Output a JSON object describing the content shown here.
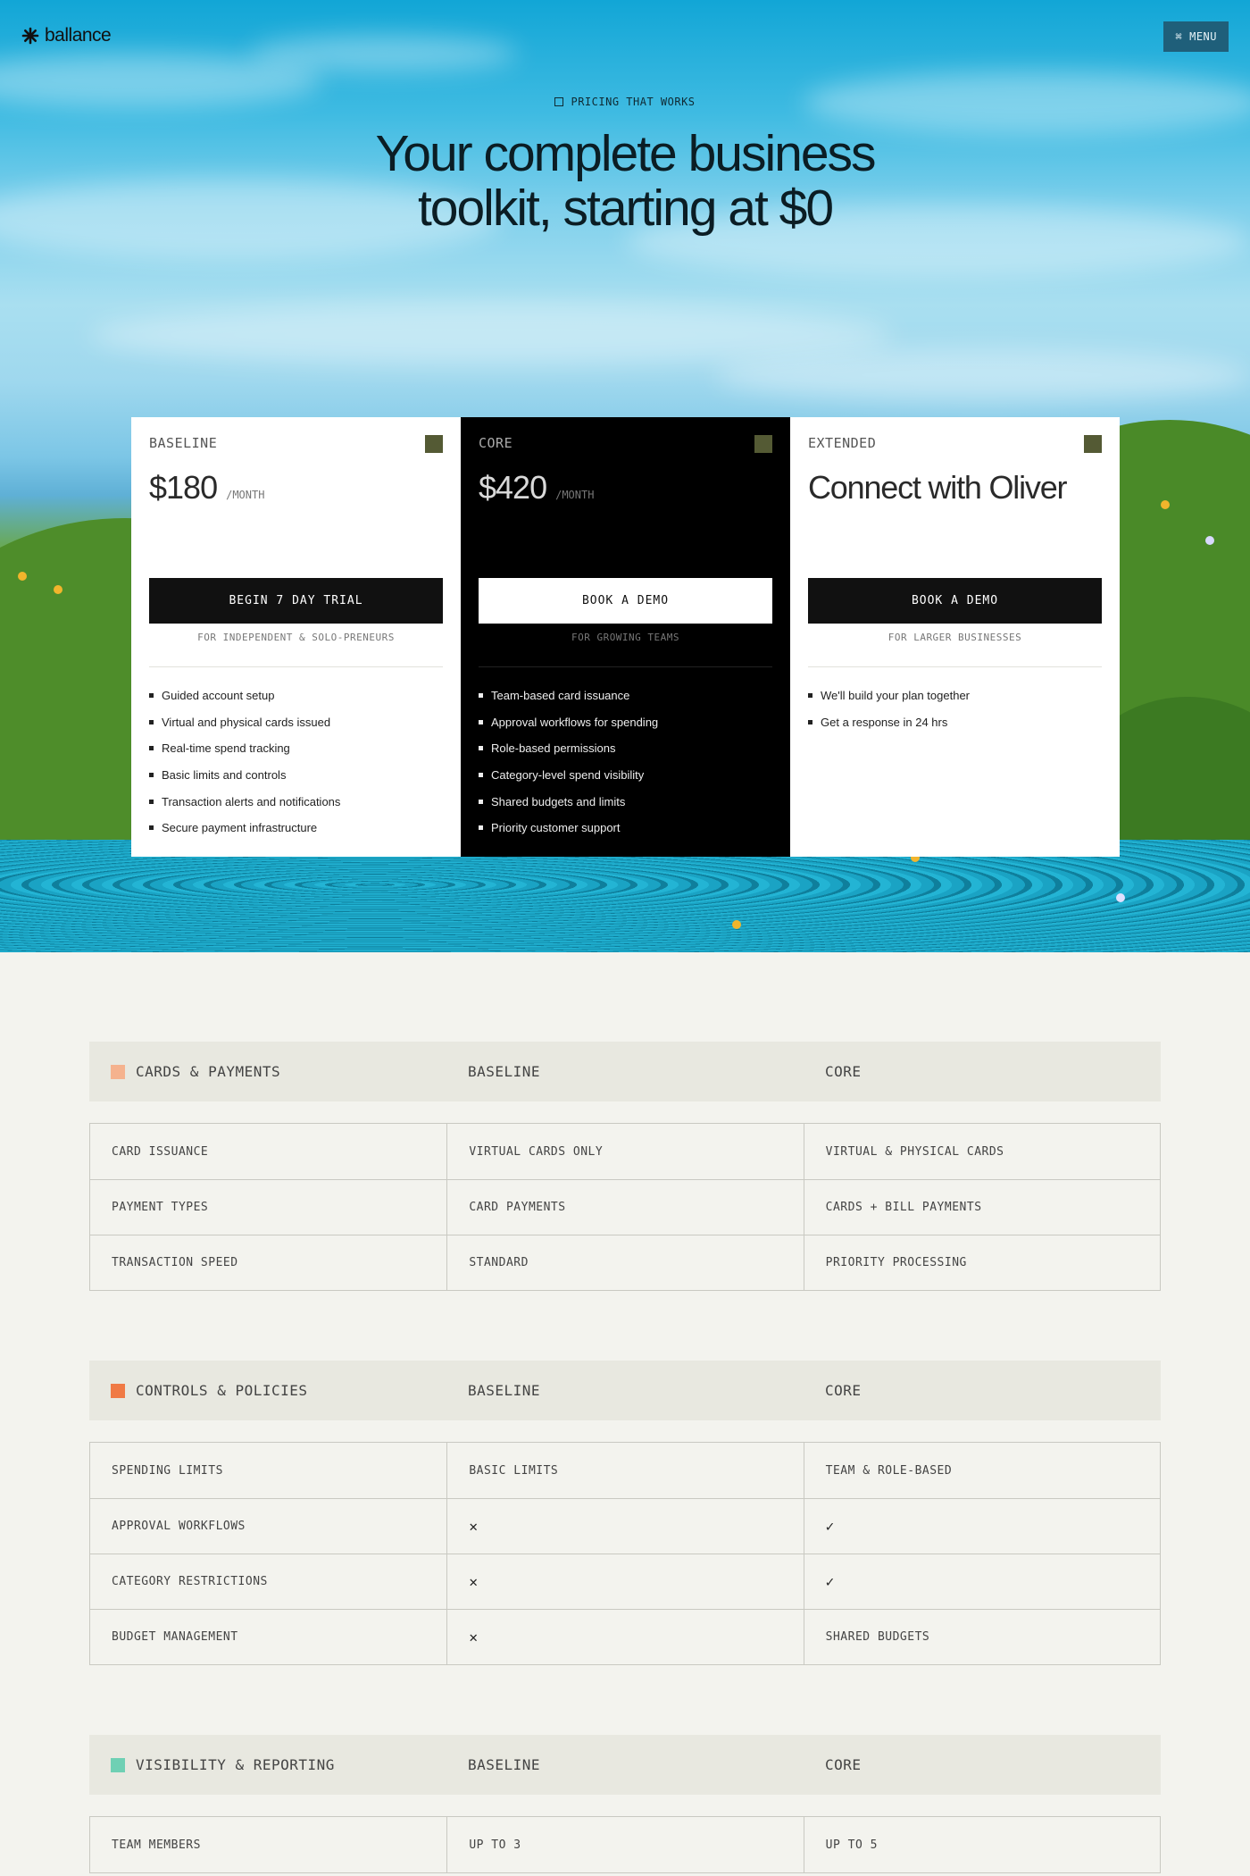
{
  "header": {
    "brand": "ballance",
    "menu_label": "MENU"
  },
  "hero": {
    "eyebrow": "PRICING THAT WORKS",
    "headline_line1": "Your complete business",
    "headline_line2": "toolkit, starting at $0"
  },
  "plans": [
    {
      "tier": "BASELINE",
      "price": "$180",
      "period": "/MONTH",
      "cta": "BEGIN 7 DAY TRIAL",
      "audience": "FOR INDEPENDENT & SOLO-PRENEURS",
      "features": [
        "Guided account setup",
        "Virtual and physical cards issued",
        "Real-time spend tracking",
        "Basic limits and controls",
        "Transaction alerts and notifications",
        "Secure payment infrastructure"
      ]
    },
    {
      "tier": "CORE",
      "price": "$420",
      "period": "/MONTH",
      "cta": "BOOK A DEMO",
      "audience": "FOR GROWING TEAMS",
      "features": [
        "Team-based card issuance",
        "Approval workflows for spending",
        "Role-based permissions",
        "Category-level spend visibility",
        "Shared budgets and limits",
        "Priority customer support"
      ]
    },
    {
      "tier": "EXTENDED",
      "headline": "Connect with Oliver",
      "cta": "BOOK A DEMO",
      "audience": "FOR LARGER BUSINESSES",
      "features": [
        "We'll build your plan together",
        "Get a response in 24 hrs"
      ]
    }
  ],
  "comparison": [
    {
      "title": "CARDS & PAYMENTS",
      "col2": "BASELINE",
      "col3": "CORE",
      "color": "#f5b28e",
      "rows": [
        [
          "CARD ISSUANCE",
          "VIRTUAL CARDS ONLY",
          "VIRTUAL & PHYSICAL CARDS"
        ],
        [
          "PAYMENT TYPES",
          "CARD PAYMENTS",
          "CARDS + BILL PAYMENTS"
        ],
        [
          "TRANSACTION SPEED",
          "STANDARD",
          "PRIORITY PROCESSING"
        ]
      ]
    },
    {
      "title": "CONTROLS & POLICIES",
      "col2": "BASELINE",
      "col3": "CORE",
      "color": "#f07a45",
      "rows": [
        [
          "SPENDING LIMITS",
          "BASIC LIMITS",
          "TEAM & ROLE-BASED"
        ],
        [
          "APPROVAL WORKFLOWS",
          "✕",
          "✓"
        ],
        [
          "CATEGORY RESTRICTIONS",
          "✕",
          "✓"
        ],
        [
          "BUDGET MANAGEMENT",
          "✕",
          "SHARED BUDGETS"
        ]
      ]
    },
    {
      "title": "VISIBILITY & REPORTING",
      "col2": "BASELINE",
      "col3": "CORE",
      "color": "#6fd0b4",
      "rows": [
        [
          "TEAM MEMBERS",
          "UP TO 3",
          "UP TO 5"
        ]
      ]
    }
  ],
  "colors": {
    "swatch": "#545a34",
    "menu_bg": "#1f5f7a"
  },
  "icons": {
    "logo": "asterisk-logo-icon",
    "menu": "command-icon",
    "eyebrow": "square-outline-icon"
  }
}
